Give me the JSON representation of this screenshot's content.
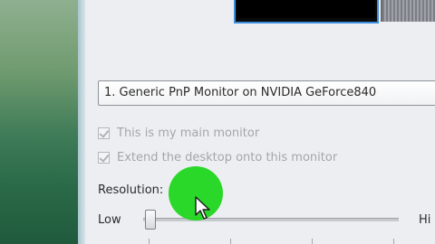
{
  "monitor_select": {
    "value": "1. Generic PnP Monitor on NVIDIA GeForce840"
  },
  "options": {
    "main_monitor_label": "This is my main monitor",
    "main_monitor_checked": true,
    "main_monitor_enabled": false,
    "extend_desktop_label": "Extend the desktop onto this monitor",
    "extend_desktop_checked": true,
    "extend_desktop_enabled": false
  },
  "resolution": {
    "label": "Resolution:",
    "low_label": "Low",
    "high_label": "Hi",
    "slider_position": 0.0
  },
  "colors": {
    "selection_border": "#3b8ee0",
    "click_highlight": "#20d61e"
  },
  "icons": {
    "cursor": "mouse-pointer-icon",
    "checkbox": "checkmark-icon"
  }
}
